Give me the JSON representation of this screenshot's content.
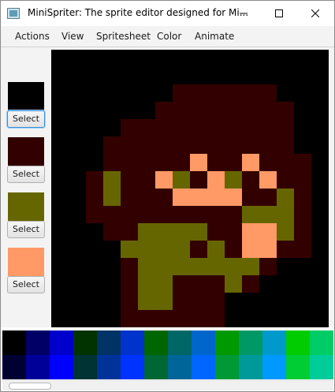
{
  "window": {
    "title": "MiniSpriter: The sprite editor designed for Mi...",
    "minimize_icon": "minimize-icon",
    "maximize_icon": "maximize-icon",
    "close_icon": "close-icon"
  },
  "menu": [
    {
      "label": "Actions"
    },
    {
      "label": "View"
    },
    {
      "label": "Spritesheet"
    },
    {
      "label": "Color"
    },
    {
      "label": "Animate"
    }
  ],
  "colors": [
    {
      "hex": "#000000",
      "button": "Select",
      "focused": true
    },
    {
      "hex": "#330000",
      "button": "Select",
      "focused": false
    },
    {
      "hex": "#666600",
      "button": "Select",
      "focused": false
    },
    {
      "hex": "#ff9966",
      "button": "Select",
      "focused": false
    }
  ],
  "sprite": {
    "size": 16,
    "rows": [
      "0000000000000000",
      "0000000000000000",
      "0000000111111000",
      "0000001111111100",
      "0000111111111100",
      "0001111111111100",
      "0001111131131110",
      "0012113213213110",
      "0012111333311210",
      "0011111111122210",
      "0001122221133210",
      "0000222212133110",
      "0000122222221000",
      "0000122111210000",
      "0000122111000000",
      "0000111111000000"
    ]
  },
  "palette": {
    "row1": [
      "#000000",
      "#000066",
      "#0000cc",
      "#003300",
      "#003366",
      "#0033cc",
      "#006600",
      "#006666",
      "#0066cc",
      "#009900",
      "#009966",
      "#0099cc",
      "#00cc00",
      "#00cc66"
    ],
    "row2": [
      "#000033",
      "#000099",
      "#0000ff",
      "#003333",
      "#003399",
      "#0033ff",
      "#006633",
      "#006699",
      "#0066ff",
      "#009933",
      "#009999",
      "#0099ff",
      "#00cc33",
      "#00cc99"
    ]
  }
}
